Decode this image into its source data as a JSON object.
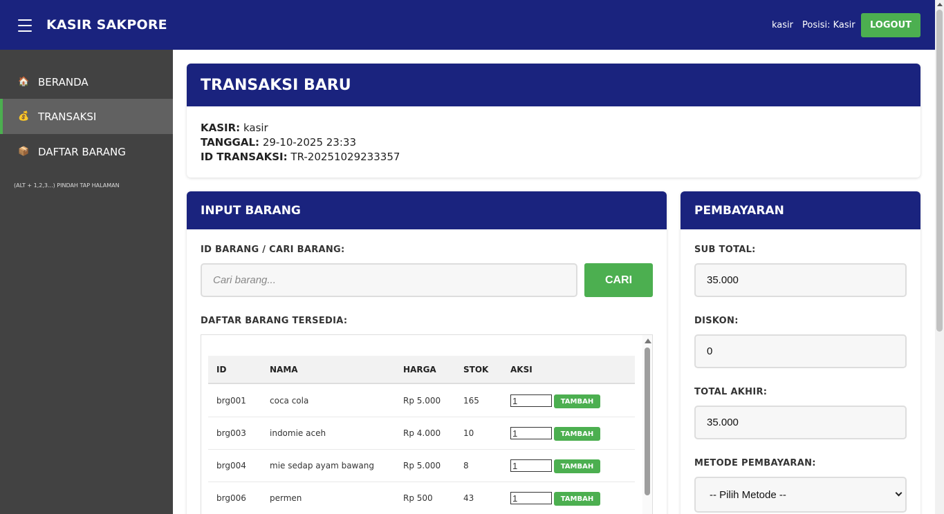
{
  "header": {
    "brand": "KASIR SAKPORE",
    "user": "kasir",
    "position": "Posisi: Kasir",
    "logout_label": "LOGOUT"
  },
  "sidebar": {
    "items": [
      {
        "icon": "house-icon",
        "glyph": "🏠",
        "label": "BERANDA",
        "active": false
      },
      {
        "icon": "money-bag-icon",
        "glyph": "💰",
        "label": "TRANSAKSI",
        "active": true
      },
      {
        "icon": "package-icon",
        "glyph": "📦",
        "label": "DAFTAR BARANG",
        "active": false
      }
    ],
    "hint": "(ALT + 1,2,3...) PINDAH TAP HALAMAN"
  },
  "transaction": {
    "title": "TRANSAKSI BARU",
    "cashier_label": "KASIR:",
    "cashier_value": "kasir",
    "date_label": "TANGGAL:",
    "date_value": "29-10-2025 23:33",
    "id_label": "ID TRANSAKSI:",
    "id_value": "TR-20251029233357"
  },
  "input_barang": {
    "title": "INPUT BARANG",
    "search_label": "ID BARANG / CARI BARANG:",
    "search_placeholder": "Cari barang...",
    "search_button": "CARI",
    "list_label": "DAFTAR BARANG TERSEDIA:",
    "columns": [
      "ID",
      "NAMA",
      "HARGA",
      "STOK",
      "AKSI"
    ],
    "rows": [
      {
        "id": "brg001",
        "name": "coca cola",
        "price": "Rp 5.000",
        "stock": "165",
        "qty": "1"
      },
      {
        "id": "brg003",
        "name": "indomie aceh",
        "price": "Rp 4.000",
        "stock": "10",
        "qty": "1"
      },
      {
        "id": "brg004",
        "name": "mie sedap ayam bawang",
        "price": "Rp 5.000",
        "stock": "8",
        "qty": "1"
      },
      {
        "id": "brg006",
        "name": "permen",
        "price": "Rp 500",
        "stock": "43",
        "qty": "1"
      }
    ],
    "add_button": "TAMBAH"
  },
  "payment": {
    "title": "PEMBAYARAN",
    "subtotal_label": "SUB TOTAL:",
    "subtotal_value": "35.000",
    "discount_label": "DISKON:",
    "discount_value": "0",
    "total_label": "TOTAL AKHIR:",
    "total_value": "35.000",
    "method_label": "METODE PEMBAYARAN:",
    "method_value": "-- Pilih Metode --"
  },
  "colors": {
    "primary": "#1a237e",
    "accent": "#4caf50",
    "sidebar": "#424242"
  }
}
